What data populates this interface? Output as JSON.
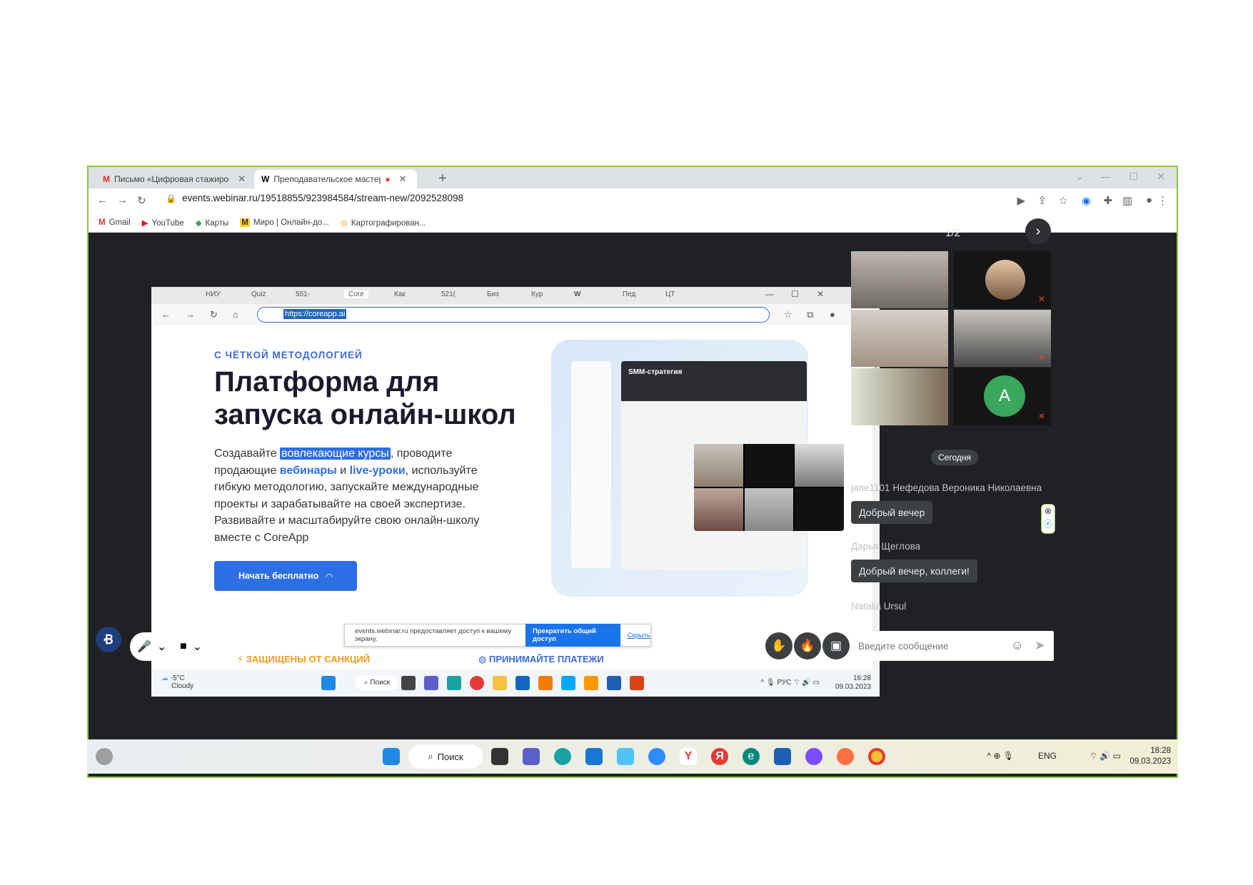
{
  "browser": {
    "tabs": [
      {
        "label": "Письмо «Цифровая стажировка",
        "active": false
      },
      {
        "label": "Преподавательское мастер",
        "active": true
      }
    ],
    "new_tab": "+",
    "url": "events.webinar.ru/19518855/923984584/stream-new/2092528098",
    "bookmarks": [
      "Gmail",
      "YouTube",
      "Карты",
      "Миро | Онлайн-до...",
      "Картографирован..."
    ]
  },
  "shared_screen": {
    "tabs": [
      "НИУ",
      "Quiz",
      "551-",
      "Core",
      "Как",
      "521(",
      "Биз",
      "Кур",
      "W",
      "Пед",
      "ЦТ"
    ],
    "url_selected": "https://coreapp.ai",
    "eyebrow": "С ЧЁТКОЙ МЕТОДОЛОГИЕЙ",
    "headline_line1": "Платформа для",
    "headline_line2": "запуска онлайн-школ",
    "lead_1": "Создавайте ",
    "lead_hl": "вовлекающие курсы",
    "lead_2": ", проводите продающие ",
    "lead_b1": "вебинары",
    "lead_3": " и ",
    "lead_b2": "live-уроки",
    "lead_4": ", используйте гибкую методологию, запускайте международные проекты и зарабатывайте на своей экспертизе. Развивайте и масштабируйте свою онлайн-школу вместе с CoreApp",
    "cta": "Начать бесплатно",
    "illustration_title": "SMM-стратегия",
    "banner_text": "events.webinar.ru предоставляет доступ к вашему экрану.",
    "banner_stop": "Прекратить общий доступ",
    "banner_hide": "Скрыть",
    "feature_1": "ЗАЩИЩЕНЫ ОТ САНКЦИЙ",
    "feature_2": "ПРИНИМАЙТЕ ПЛАТЕЖИ",
    "taskbar": {
      "weather_temp": "-5°C",
      "weather_desc": "Cloudy",
      "search": "Поиск",
      "lang": "РУС",
      "time": "16:28",
      "date": "09.03.2023"
    }
  },
  "sidebar": {
    "pager": "1/2",
    "avatar_letter": "A",
    "today": "Сегодня",
    "messages": [
      {
        "author": "jane1101 Нефедова Вероника Николаевна",
        "text": "Добрый вечер"
      },
      {
        "author": "Дарья Щеглова",
        "text": "Добрый вечер, коллеги!"
      },
      {
        "author": "Natalia Ursul",
        "text": ""
      }
    ],
    "input_placeholder": "Введите сообщение"
  },
  "os_taskbar": {
    "search": "Поиск",
    "lang": "ENG",
    "time": "18:28",
    "date": "09.03.2023"
  },
  "colors": {
    "accent": "#2d6ee4",
    "frame_border": "#8bc34a",
    "stage_bg": "#202124"
  }
}
